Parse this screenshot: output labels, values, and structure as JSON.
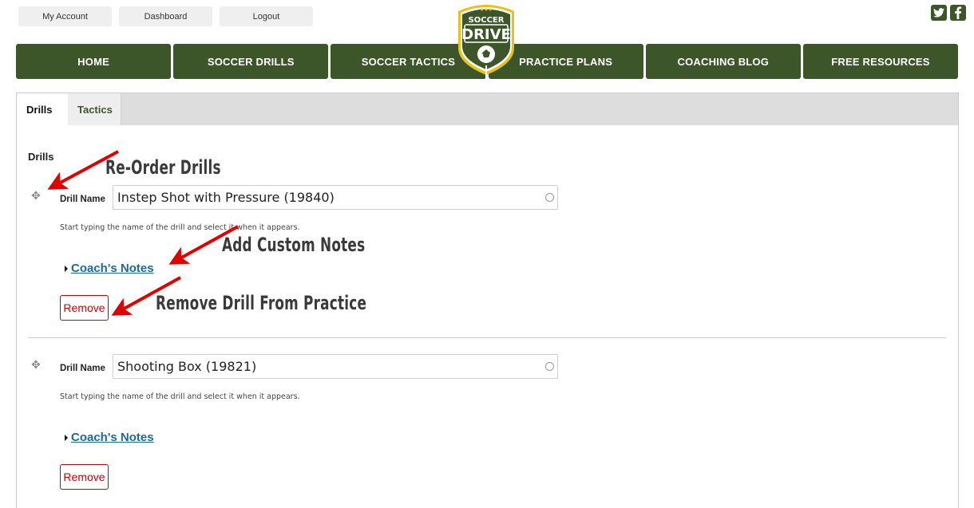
{
  "top_links": [
    "My Account",
    "Dashboard",
    "Logout"
  ],
  "social": {
    "twitter": "twitter-icon",
    "facebook": "facebook-icon"
  },
  "logo": {
    "line1": "SOCCER",
    "line2": "DRIVE"
  },
  "nav": [
    "HOME",
    "SOCCER DRILLS",
    "SOCCER TACTICS",
    "PRACTICE PLANS",
    "COACHING BLOG",
    "FREE RESOURCES"
  ],
  "tabs": [
    {
      "label": "Drills",
      "active": true
    },
    {
      "label": "Tactics",
      "active": false
    }
  ],
  "section_title": "Drills",
  "drills": [
    {
      "label": "Drill Name",
      "value": "Instep Shot with Pressure (19840)",
      "help": "Start typing the name of the drill and select it when it appears.",
      "notes_label": "Coach's Notes",
      "remove_label": "Remove"
    },
    {
      "label": "Drill Name",
      "value": "Shooting Box (19821)",
      "help": "Start typing the name of the drill and select it when it appears.",
      "notes_label": "Coach's Notes",
      "remove_label": "Remove"
    }
  ],
  "annotations": {
    "reorder": "Re-Order Drills",
    "notes": "Add Custom Notes",
    "remove": "Remove Drill From Practice"
  },
  "colors": {
    "brand_green": "#3d5629",
    "remove_red": "#cc0000",
    "link_blue": "#1a6a9e",
    "arrow_red": "#e00000"
  }
}
